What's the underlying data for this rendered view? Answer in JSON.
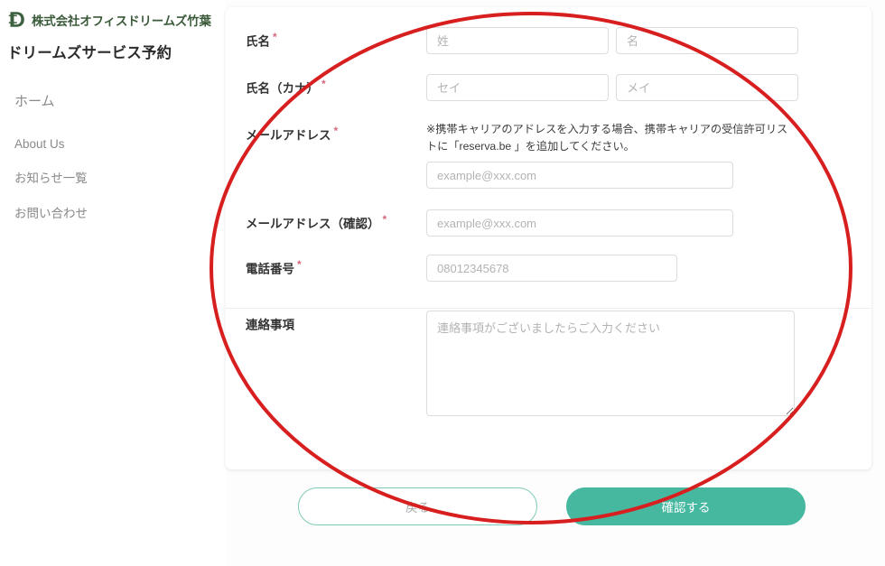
{
  "colors": {
    "accent_teal": "#46b8a0",
    "brand_green": "#3a5a3a",
    "required_asterisk": "#d46a7e",
    "annotation_red": "#d81f1f",
    "input_border": "#dcdcdc",
    "placeholder": "#b3b3b3",
    "page_background": "#fdfdfd"
  },
  "sidebar": {
    "logo_icon": "company-monogram-d-icon",
    "company_name": "株式会社オフィスドリームズ竹葉",
    "site_title": "ドリームズサービス予約",
    "home": {
      "label": "ホーム"
    },
    "items": [
      {
        "label": "About Us"
      },
      {
        "label": "お知らせ一覧"
      },
      {
        "label": "お問い合わせ"
      }
    ]
  },
  "form": {
    "fields": {
      "name": {
        "label": "氏名",
        "required_mark": "*",
        "last_placeholder": "姓",
        "first_placeholder": "名",
        "last_value": "",
        "first_value": ""
      },
      "name_kana": {
        "label": "氏名（カナ）",
        "required_mark": "*",
        "last_placeholder": "セイ",
        "first_placeholder": "メイ",
        "last_value": "",
        "first_value": ""
      },
      "email": {
        "label": "メールアドレス",
        "required_mark": "*",
        "note": "※携帯キャリアのアドレスを入力する場合、携帯キャリアの受信許可リストに「reserva.be 」を追加してください。",
        "placeholder": "example@xxx.com",
        "value": ""
      },
      "email_confirm": {
        "label": "メールアドレス（確認）",
        "required_mark": "*",
        "placeholder": "example@xxx.com",
        "value": ""
      },
      "tel": {
        "label": "電話番号",
        "required_mark": "*",
        "placeholder": "08012345678",
        "value": ""
      },
      "message": {
        "label": "連絡事項",
        "required_mark": "",
        "placeholder": "連絡事項がございましたらご入力ください",
        "value": ""
      }
    },
    "buttons": {
      "back": "戻る",
      "confirm": "確認する"
    }
  },
  "annotation": {
    "shape": "red-ellipse-highlight",
    "target": "reservation-form-card-and-buttons"
  }
}
